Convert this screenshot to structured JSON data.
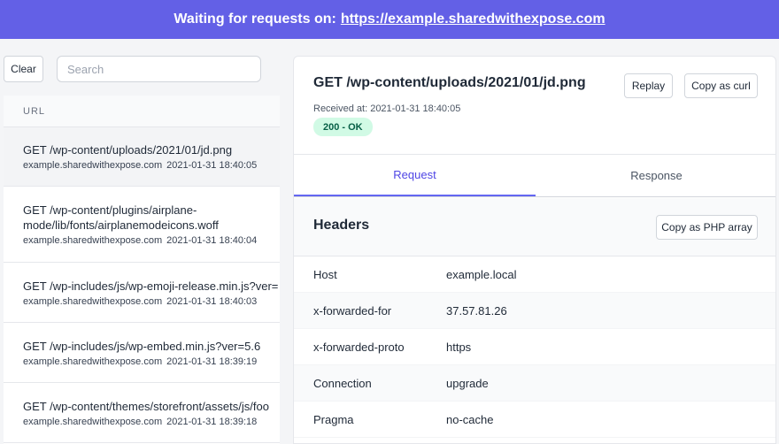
{
  "banner": {
    "text": "Waiting for requests on:",
    "url": "https://example.sharedwithexpose.com"
  },
  "toolbar": {
    "clear_label": "Clear",
    "search_placeholder": "Search",
    "search_value": ""
  },
  "list": {
    "header": "URL",
    "items": [
      {
        "title": "GET /wp-content/uploads/2021/01/jd.png",
        "host": "example.sharedwithexpose.com",
        "time": "2021-01-31 18:40:05"
      },
      {
        "title": "GET /wp-content/plugins/airplane-mode/lib/fonts/airplanemodeicons.woff",
        "host": "example.sharedwithexpose.com",
        "time": "2021-01-31 18:40:04"
      },
      {
        "title": "GET /wp-includes/js/wp-emoji-release.min.js?ver=",
        "host": "example.sharedwithexpose.com",
        "time": "2021-01-31 18:40:03"
      },
      {
        "title": "GET /wp-includes/js/wp-embed.min.js?ver=5.6",
        "host": "example.sharedwithexpose.com",
        "time": "2021-01-31 18:39:19"
      },
      {
        "title": "GET /wp-content/themes/storefront/assets/js/foo",
        "host": "example.sharedwithexpose.com",
        "time": "2021-01-31 18:39:18"
      }
    ]
  },
  "detail": {
    "title": "GET /wp-content/uploads/2021/01/jd.png",
    "replay_label": "Replay",
    "curl_label": "Copy as curl",
    "received": "Received at: 2021-01-31 18:40:05",
    "status": "200 - OK",
    "tabs": [
      {
        "label": "Request"
      },
      {
        "label": "Response"
      }
    ],
    "headers_title": "Headers",
    "php_label": "Copy as PHP array",
    "headers": [
      {
        "key": "Host",
        "value": "example.local"
      },
      {
        "key": "x-forwarded-for",
        "value": "37.57.81.26"
      },
      {
        "key": "x-forwarded-proto",
        "value": "https"
      },
      {
        "key": "Connection",
        "value": "upgrade"
      },
      {
        "key": "Pragma",
        "value": "no-cache"
      }
    ]
  },
  "colors": {
    "banner": "#6360e6",
    "accent": "#4f46e5",
    "status_bg": "#d1fae5",
    "status_text": "#065f46"
  }
}
